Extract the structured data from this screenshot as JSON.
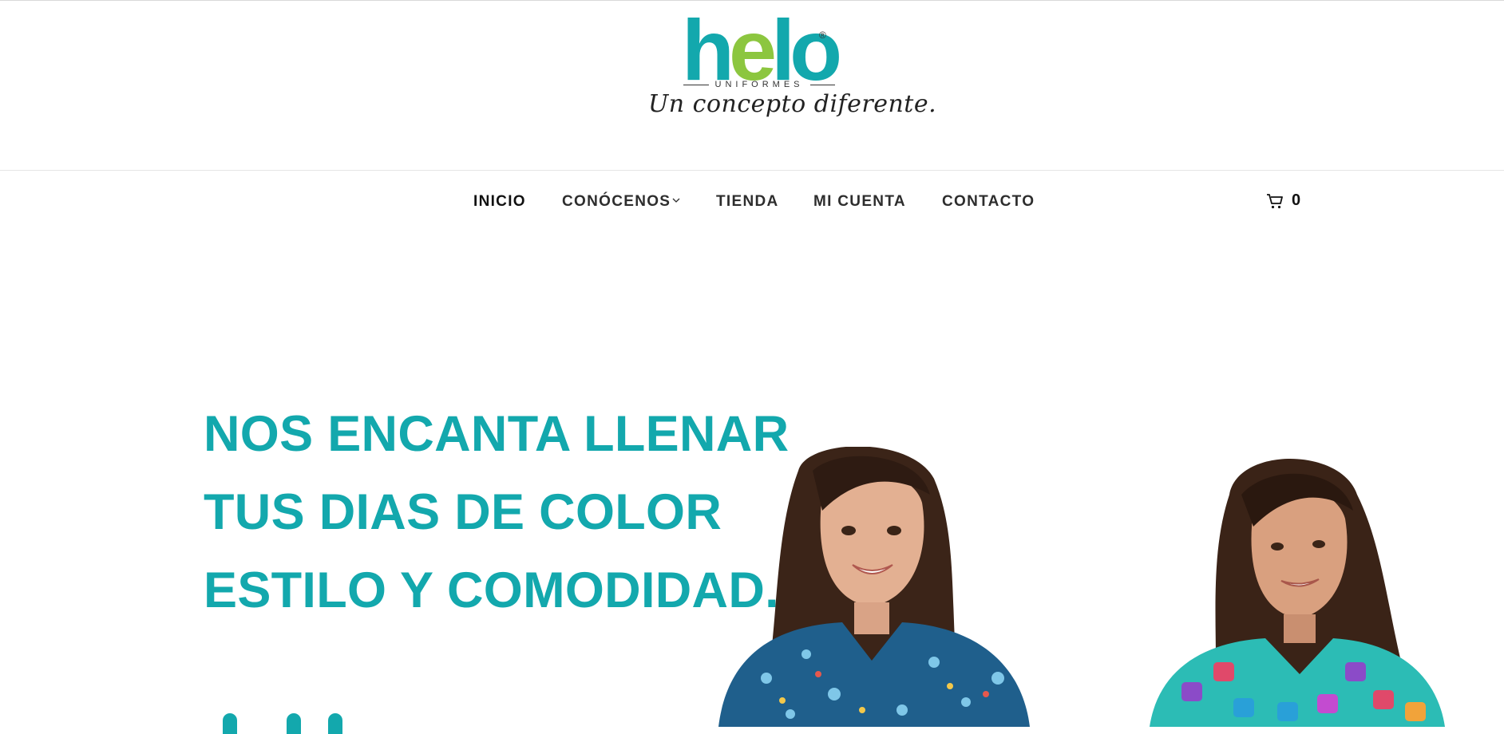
{
  "brand": {
    "logo_word_part1": "h",
    "logo_word_part2": "e",
    "logo_word_part3": "lo",
    "logo_registered": "®",
    "logo_subline": "UNIFORMES",
    "logo_tagline": "Un concepto diferente.",
    "colors": {
      "teal": "#13a8ad",
      "green": "#8cc63f"
    }
  },
  "nav": {
    "items": [
      {
        "label": "INICIO"
      },
      {
        "label": "CONÓCENOS"
      },
      {
        "label": "TIENDA"
      },
      {
        "label": "MI CUENTA"
      },
      {
        "label": "CONTACTO"
      }
    ],
    "cart_icon": "cart-icon",
    "cart_count": "0"
  },
  "hero": {
    "lines": [
      "NOS ENCANTA LLENAR",
      "TUS DIAS DE COLOR",
      "ESTILO Y COMODIDAD."
    ],
    "image": "two-women-in-patterned-scrubs"
  }
}
